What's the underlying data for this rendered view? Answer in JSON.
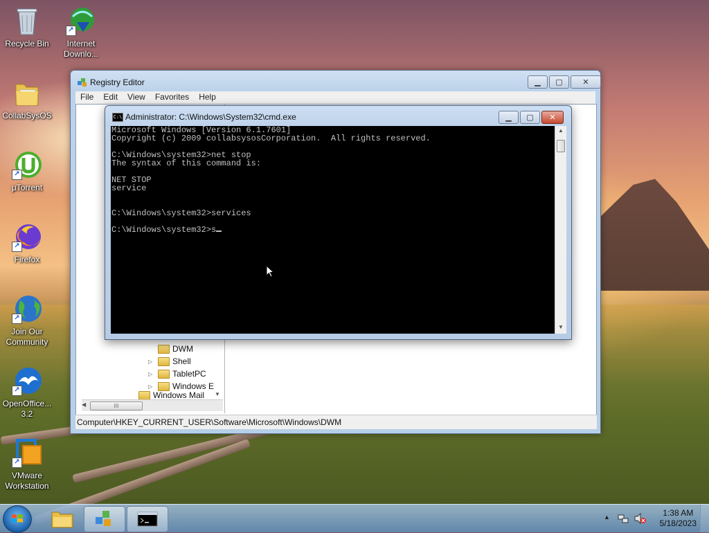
{
  "desktop": {
    "icons": [
      {
        "label": "Recycle Bin",
        "icon": "recycle-bin-icon"
      },
      {
        "label": "Internet Downlo...",
        "icon": "internet-download-manager-icon"
      },
      {
        "label": "CollabSysOS",
        "icon": "folder-icon"
      },
      {
        "label": "µTorrent",
        "icon": "utorrent-icon"
      },
      {
        "label": "Firefox",
        "icon": "firefox-icon"
      },
      {
        "label": "Join Our Community",
        "icon": "globe-icon"
      },
      {
        "label": "OpenOffice... 3.2",
        "icon": "openoffice-icon"
      },
      {
        "label": "VMware Workstation",
        "icon": "vmware-icon"
      }
    ]
  },
  "registry": {
    "title": "Registry Editor",
    "menu": [
      "File",
      "Edit",
      "View",
      "Favorites",
      "Help"
    ],
    "tree": [
      "DWM",
      "Shell",
      "TabletPC",
      "Windows E",
      "Windows Mail"
    ],
    "scroll_grip": "III",
    "status": "Computer\\HKEY_CURRENT_USER\\Software\\Microsoft\\Windows\\DWM",
    "buttons": {
      "minimize": "▁",
      "maximize": "▢",
      "close": "✕"
    }
  },
  "cmd": {
    "title": "Administrator: C:\\Windows\\System32\\cmd.exe",
    "icon_text": "C:\\",
    "output": "Microsoft Windows [Version 6.1.7601]\nCopyright (c) 2009 collabsysosCorporation.  All rights reserved.\n\nC:\\Windows\\system32>net stop\nThe syntax of this command is:\n\nNET STOP\nservice\n\n\nC:\\Windows\\system32>services\n\nC:\\Windows\\system32>s",
    "buttons": {
      "minimize": "▁",
      "maximize": "▢",
      "close": "✕"
    }
  },
  "taskbar": {
    "time": "1:38 AM",
    "date": "5/18/2023"
  },
  "colors": {
    "console_bg": "#000000",
    "console_fg": "#c0c0c0",
    "close_red": "#c74a2f"
  }
}
